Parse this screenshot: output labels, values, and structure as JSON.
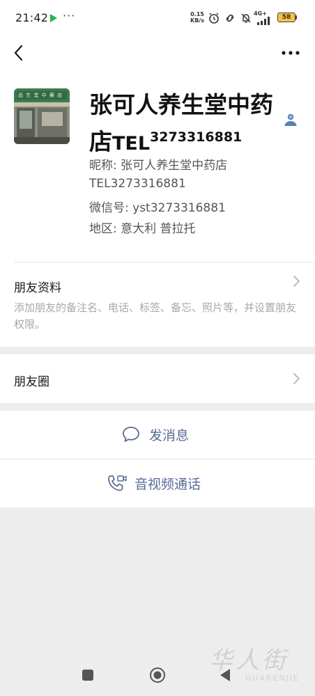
{
  "status_bar": {
    "time": "21:42",
    "dots": "···",
    "net_speed_value": "0.15",
    "net_speed_unit": "KB/s",
    "net_type": "4G+",
    "battery": "58",
    "icons": [
      "play-store-icon",
      "alarm-icon",
      "link-icon",
      "mute-icon",
      "signal-icon",
      "battery-icon"
    ]
  },
  "header": {
    "back_icon": "chevron-left-icon",
    "more_icon": "more-dots-icon"
  },
  "profile": {
    "name_main": "张可人养生堂中药店",
    "name_tel": "TEL",
    "name_number": "3273316881",
    "avatar_sign_text": "品 生 堂 中 藥 店",
    "nickname_label": "昵称:",
    "nickname_value": "张可人养生堂中药店",
    "tel_line": "TEL3273316881",
    "wechat_label": "微信号:",
    "wechat_value": "yst3273316881",
    "region_label": "地区:",
    "region_value": "意大利  普拉托"
  },
  "friend_info": {
    "title": "朋友资料",
    "desc": "添加朋友的备注名、电话、标签、备忘、照片等，并设置朋友权限。"
  },
  "moments": {
    "title": "朋友圈"
  },
  "actions": {
    "message_label": "发消息",
    "call_label": "音视频通话"
  },
  "watermark": {
    "top": "华人街",
    "bottom": "HUARENJIE"
  },
  "colors": {
    "link_blue": "#576b95",
    "background": "#ededed",
    "card": "#ffffff",
    "hint_gray": "#a8a8a8"
  }
}
